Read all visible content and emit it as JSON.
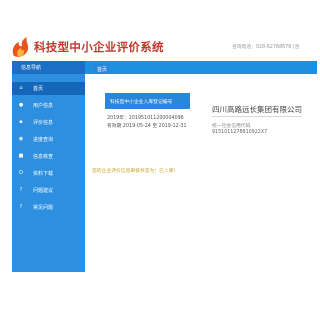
{
  "header": {
    "title": "科技型中小企业评价系统",
    "hotline": "咨询电话：028-62788678 (咨"
  },
  "sidebar": {
    "title": "信息导航",
    "items": [
      {
        "label": "首页",
        "icon": "home-icon"
      },
      {
        "label": "用户信息",
        "icon": "user-icon"
      },
      {
        "label": "评价信息",
        "icon": "document-icon"
      },
      {
        "label": "进度查询",
        "icon": "search-icon"
      },
      {
        "label": "信息核查",
        "icon": "check-icon"
      },
      {
        "label": "资料下载",
        "icon": "download-icon"
      },
      {
        "label": "问题建议",
        "icon": "question-icon"
      },
      {
        "label": "常见问题",
        "icon": "question-icon"
      }
    ],
    "active_index": 0
  },
  "tabs": [
    {
      "label": "首页"
    }
  ],
  "certificate": {
    "badge": "科技型中小企业入库登记编号",
    "number": "2019年：20195101120000409​6",
    "validity": "有效期 2019-05-24 至 2019-12-31"
  },
  "company": {
    "name": "四川高路远长集团有限公司",
    "credit_label": "统一社会信用代码",
    "credit_code": "91510112788109​22X7"
  },
  "status_text": "您的企业评价信息审核状态为：已入库！",
  "colors": {
    "brand_red": "#c0392b",
    "nav_blue": "#2d8fe0",
    "nav_active": "#1467b8",
    "accent_yellow": "#c9a227"
  }
}
